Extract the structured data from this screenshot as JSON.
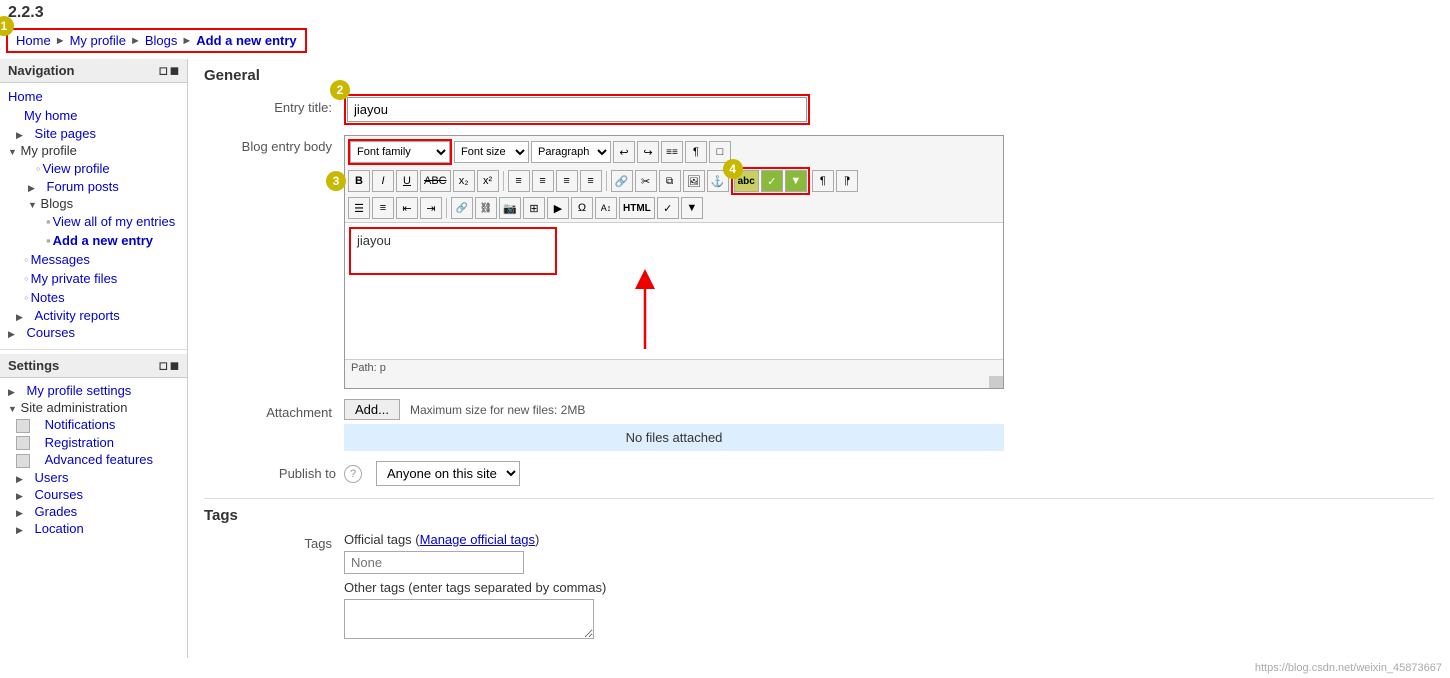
{
  "version": "2.2.3",
  "breadcrumb": {
    "home": "Home",
    "myProfile": "My profile",
    "blogs": "Blogs",
    "addNewEntry": "Add a new entry"
  },
  "navigation": {
    "sectionTitle": "Navigation",
    "items": [
      {
        "label": "Home",
        "type": "link",
        "indent": 0
      },
      {
        "label": "My home",
        "type": "link",
        "indent": 1
      },
      {
        "label": "Site pages",
        "type": "collapsible",
        "indent": 1
      },
      {
        "label": "My profile",
        "type": "expanded",
        "indent": 0
      },
      {
        "label": "View profile",
        "type": "link",
        "indent": 2
      },
      {
        "label": "Forum posts",
        "type": "collapsible",
        "indent": 2
      },
      {
        "label": "Blogs",
        "type": "expanded",
        "indent": 2
      },
      {
        "label": "View all of my entries",
        "type": "link",
        "indent": 3
      },
      {
        "label": "Add a new entry",
        "type": "link",
        "indent": 3
      },
      {
        "label": "Messages",
        "type": "link",
        "indent": 1
      },
      {
        "label": "My private files",
        "type": "link",
        "indent": 1
      },
      {
        "label": "Notes",
        "type": "link",
        "indent": 1
      },
      {
        "label": "Activity reports",
        "type": "collapsible",
        "indent": 1
      },
      {
        "label": "Courses",
        "type": "collapsible",
        "indent": 0
      }
    ]
  },
  "settings": {
    "sectionTitle": "Settings",
    "items": [
      {
        "label": "My profile settings",
        "type": "collapsible",
        "indent": 0
      },
      {
        "label": "Site administration",
        "type": "expanded",
        "indent": 0
      },
      {
        "label": "Notifications",
        "type": "link",
        "indent": 1
      },
      {
        "label": "Registration",
        "type": "link",
        "indent": 1
      },
      {
        "label": "Advanced features",
        "type": "link",
        "indent": 1
      },
      {
        "label": "Users",
        "type": "collapsible",
        "indent": 1
      },
      {
        "label": "Courses",
        "type": "collapsible",
        "indent": 1
      },
      {
        "label": "Grades",
        "type": "collapsible",
        "indent": 1
      },
      {
        "label": "Location",
        "type": "collapsible",
        "indent": 1
      }
    ]
  },
  "general": {
    "sectionTitle": "General",
    "entryTitleLabel": "Entry title:",
    "entryTitleValue": "jiayou",
    "blogEntryBodyLabel": "Blog entry body",
    "toolbar": {
      "fontFamily": "Font family",
      "fontSize": "Font size",
      "paragraph": "Paragraph",
      "buttons": [
        "↩",
        "↪",
        "≡≡",
        "¶",
        "□",
        "B",
        "I",
        "U",
        "ABC",
        "x₂",
        "x²",
        "≡",
        "≡",
        "≡",
        "≡",
        "≡",
        "≡",
        "🔗",
        "✂",
        "📋",
        "📷",
        "📌",
        "Ω",
        "🔡",
        "HTML",
        "✓",
        "▼"
      ]
    },
    "editorContent": "jiayou",
    "pathLabel": "Path: p"
  },
  "attachment": {
    "label": "Attachment",
    "addButton": "Add...",
    "maxSizeInfo": "Maximum size for new files: 2MB",
    "noFilesText": "No files attached"
  },
  "publishTo": {
    "label": "Publish to",
    "helpIcon": "?",
    "value": "Anyone on this site",
    "dropdownIcon": "▾"
  },
  "tags": {
    "sectionTitle": "Tags",
    "label": "Tags",
    "officialTagsText": "Official tags",
    "manageOfficialTagsText": "Manage official tags",
    "nonePlaceholder": "None",
    "otherTagsLabel": "Other tags (enter tags separated by commas)"
  },
  "annotations": {
    "1": "1",
    "2": "2",
    "3": "3",
    "4": "4"
  },
  "watermark": "https://blog.csdn.net/weixin_45873667"
}
